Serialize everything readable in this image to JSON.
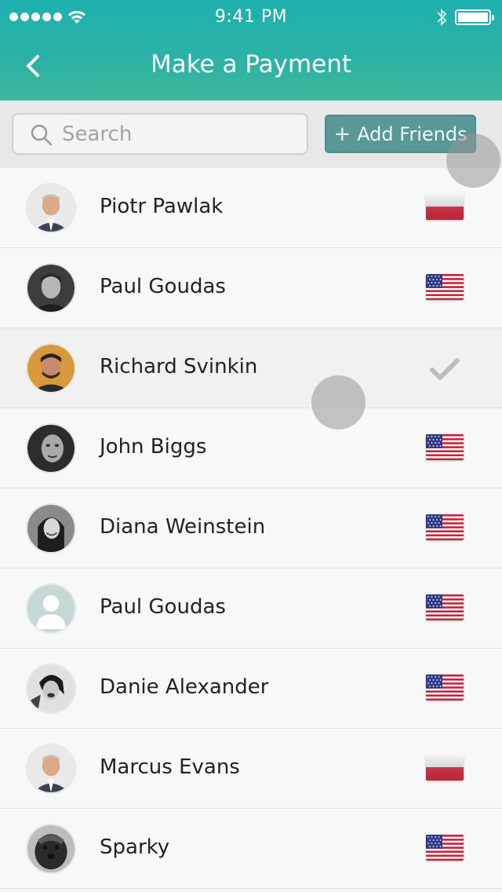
{
  "status_bar": {
    "time": "9:41 PM",
    "signal_icon": "signal-dots-icon",
    "wifi_icon": "wifi-icon",
    "bluetooth_icon": "bluetooth-icon",
    "battery_icon": "battery-icon"
  },
  "nav": {
    "title": "Make a Payment",
    "back_icon": "chevron-left-icon"
  },
  "search": {
    "placeholder": "Search",
    "value": "",
    "icon": "search-icon"
  },
  "add_friends": {
    "plus": "+",
    "label": "Add Friends"
  },
  "colors": {
    "header_top": "#1fb0b0",
    "header_bottom": "#3cb89a",
    "add_button": "#5a9898"
  },
  "friends": [
    {
      "name": "Piotr Pawlak",
      "flag": "poland-flag-icon",
      "selected": false
    },
    {
      "name": "Paul Goudas",
      "flag": "usa-flag-icon",
      "selected": false
    },
    {
      "name": "Richard Svinkin",
      "flag": "checkmark-icon",
      "selected": true
    },
    {
      "name": "John Biggs",
      "flag": "usa-flag-icon",
      "selected": false
    },
    {
      "name": "Diana Weinstein",
      "flag": "usa-flag-icon",
      "selected": false
    },
    {
      "name": "Paul Goudas",
      "flag": "usa-flag-icon",
      "selected": false
    },
    {
      "name": "Danie Alexander",
      "flag": "usa-flag-icon",
      "selected": false
    },
    {
      "name": "Marcus Evans",
      "flag": "poland-flag-icon",
      "selected": false
    },
    {
      "name": "Sparky",
      "flag": "usa-flag-icon",
      "selected": false
    }
  ]
}
